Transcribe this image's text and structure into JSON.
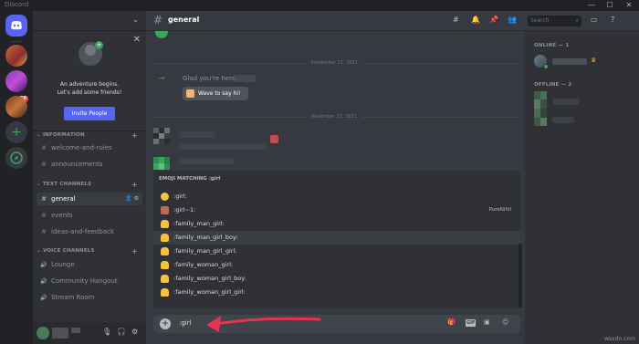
{
  "window": {
    "title": "Discord",
    "minimize": "—",
    "maximize": "☐",
    "close": "✕"
  },
  "sidebar": {
    "promo": {
      "line1": "An adventure begins.",
      "line2": "Let's add some friends!",
      "button": "Invite People"
    },
    "categories": {
      "information": "INFORMATION",
      "text": "TEXT CHANNELS",
      "voice": "VOICE CHANNELS"
    },
    "info_channels": [
      "welcome-and-rules",
      "announcements"
    ],
    "text_channels": [
      "general",
      "events",
      "ideas-and-feedback"
    ],
    "voice_channels": [
      "Lounge",
      "Community Hangout",
      "Stream Room"
    ],
    "active_channel": "general"
  },
  "servers": {
    "badge": "50"
  },
  "header": {
    "channel": "general",
    "search_placeholder": "Search"
  },
  "messages": {
    "date1": "September 21, 2021",
    "welcome": "Glad you're here,",
    "wave_button": "Wave to say hi!",
    "date2": "November 15, 2021"
  },
  "emoji_popup": {
    "heading_prefix": "EMOJI MATCHING",
    "heading_query": ":girl",
    "items": [
      {
        "name": ":girl:",
        "source": ""
      },
      {
        "name": ":girl~1:",
        "source": "PureNihil"
      },
      {
        "name": ":family_man_girl:",
        "source": ""
      },
      {
        "name": ":family_man_girl_boy:",
        "source": ""
      },
      {
        "name": ":family_man_girl_girl:",
        "source": ""
      },
      {
        "name": ":family_woman_girl:",
        "source": ""
      },
      {
        "name": ":family_woman_girl_boy:",
        "source": ""
      },
      {
        "name": ":family_woman_girl_girl:",
        "source": ""
      }
    ],
    "selected_index": 3
  },
  "composer": {
    "text": ":girl",
    "gif": "GIF"
  },
  "members": {
    "online": "ONLINE — 1",
    "offline": "OFFLINE — 2"
  },
  "watermark": "wsxdn.com",
  "colors": {
    "accent": "#5865f2",
    "online": "#3ba55c",
    "annotation_arrow": "#e8334f"
  }
}
